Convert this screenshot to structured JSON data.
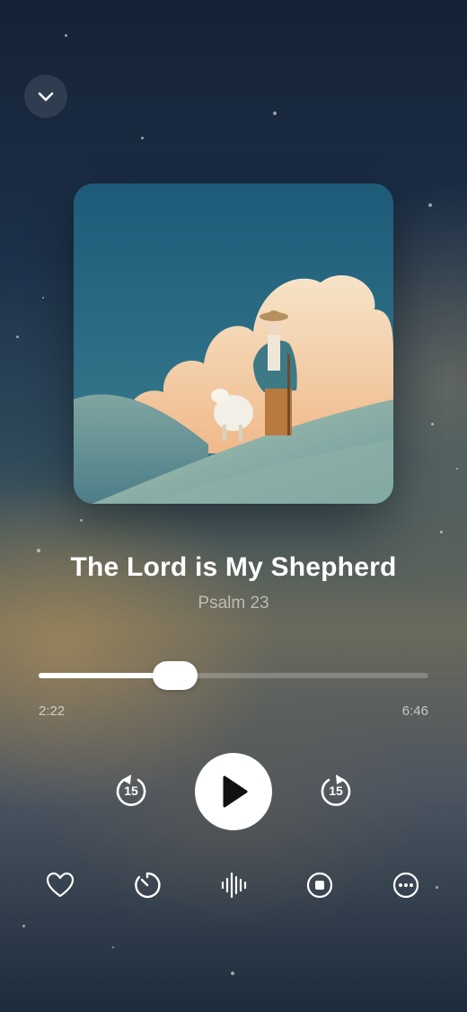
{
  "header": {
    "collapse_icon": "chevron-down-icon"
  },
  "track": {
    "title": "The Lord is My Shepherd",
    "subtitle": "Psalm 23",
    "artwork_icon": "shepherd-artwork"
  },
  "progress": {
    "elapsed": "2:22",
    "duration": "6:46",
    "fraction": 0.35
  },
  "controls": {
    "skip_back_label": "15",
    "skip_forward_label": "15",
    "play_icon": "play-icon"
  },
  "actions": [
    {
      "icon": "heart-icon"
    },
    {
      "icon": "timer-icon"
    },
    {
      "icon": "waveform-icon"
    },
    {
      "icon": "stop-icon"
    },
    {
      "icon": "more-icon"
    }
  ],
  "colors": {
    "background_top": "#152235",
    "accent": "#ffffff"
  }
}
